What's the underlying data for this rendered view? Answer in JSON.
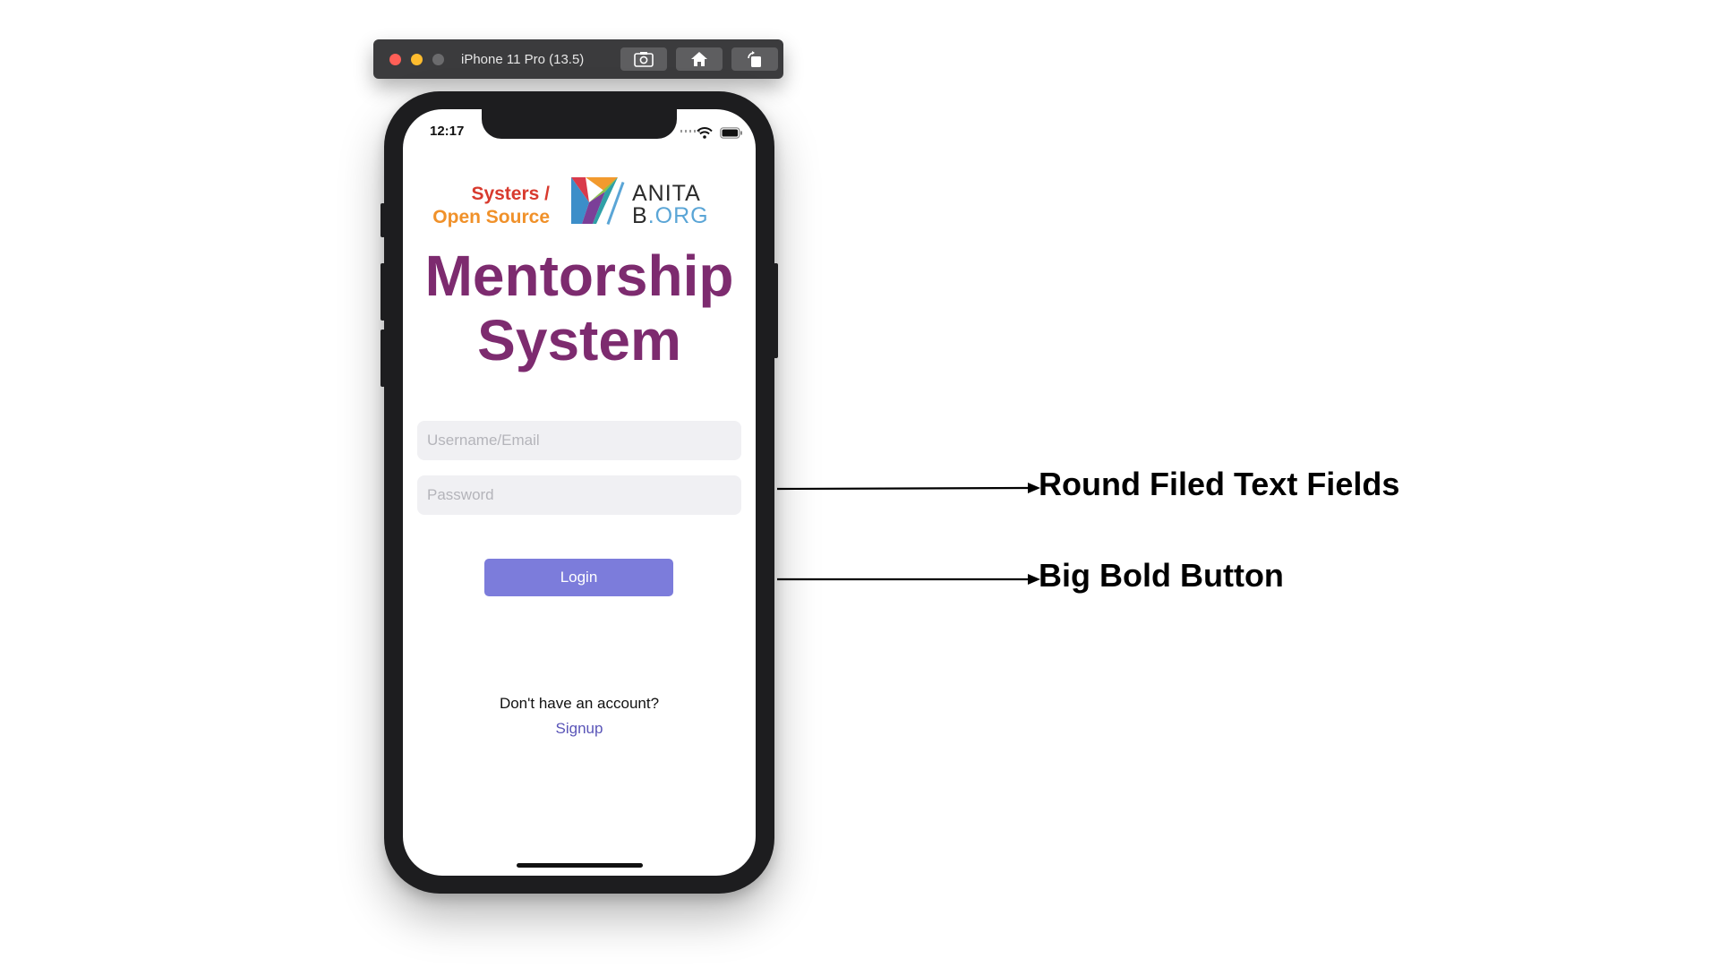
{
  "simulator": {
    "device_title": "iPhone 11 Pro (13.5)",
    "buttons": [
      {
        "icon": "screenshot-icon"
      },
      {
        "icon": "home-icon"
      },
      {
        "icon": "rotate-icon"
      }
    ],
    "traffic_light_colors": [
      "#ff5f57",
      "#febc2e",
      "#6b6b6d"
    ]
  },
  "status_bar": {
    "time": "12:17",
    "icons": [
      "signal-dots-icon",
      "wifi-icon",
      "battery-icon"
    ]
  },
  "logos": {
    "systers_line1": "Systers /",
    "systers_line2": "Open Source",
    "anita_line1": "ANITA",
    "anita_line2_b": "B",
    "anita_line2_rest": ".ORG"
  },
  "app": {
    "title_line1": "Mentorship",
    "title_line2": "System",
    "username_placeholder": "Username/Email",
    "password_placeholder": "Password",
    "login_label": "Login",
    "no_account_text": "Don't have an account?",
    "signup_label": "Signup"
  },
  "annotations": {
    "fields_label": "Round Filed Text Fields",
    "button_label": "Big Bold Button"
  },
  "colors": {
    "title": "#7d2b6f",
    "button": "#7c7cdb",
    "link": "#5a55b8",
    "field_bg": "#f0f0f3"
  }
}
